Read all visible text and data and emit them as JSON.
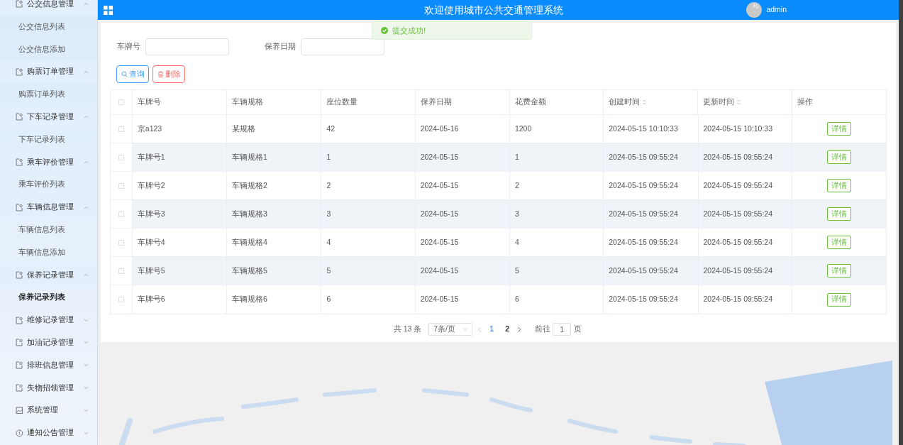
{
  "header": {
    "title": "欢迎使用城市公共交通管理系统",
    "user": "admin"
  },
  "toast": {
    "kind": "success",
    "text": "提交成功!"
  },
  "sidebar": {
    "groups": [
      {
        "label": "公交信息管理",
        "kind": "doc",
        "expanded": true,
        "children": [
          {
            "label": "公交信息列表",
            "selected": false
          },
          {
            "label": "公交信息添加",
            "selected": false
          }
        ]
      },
      {
        "label": "购票订单管理",
        "kind": "doc",
        "expanded": true,
        "children": [
          {
            "label": "购票订单列表",
            "selected": false
          }
        ]
      },
      {
        "label": "下车记录管理",
        "kind": "doc",
        "expanded": true,
        "children": [
          {
            "label": "下车记录列表",
            "selected": false
          }
        ]
      },
      {
        "label": "乘车评价管理",
        "kind": "doc",
        "expanded": true,
        "children": [
          {
            "label": "乘车评价列表",
            "selected": false
          }
        ]
      },
      {
        "label": "车辆信息管理",
        "kind": "doc",
        "expanded": true,
        "children": [
          {
            "label": "车辆信息列表",
            "selected": false
          },
          {
            "label": "车辆信息添加",
            "selected": false
          }
        ]
      },
      {
        "label": "保养记录管理",
        "kind": "doc",
        "expanded": true,
        "children": [
          {
            "label": "保养记录列表",
            "selected": true
          }
        ]
      },
      {
        "label": "维修记录管理",
        "kind": "doc",
        "expanded": false
      },
      {
        "label": "加油记录管理",
        "kind": "doc",
        "expanded": false
      },
      {
        "label": "排班信息管理",
        "kind": "doc",
        "expanded": false
      },
      {
        "label": "失物招领管理",
        "kind": "doc",
        "expanded": false
      },
      {
        "label": "系统管理",
        "kind": "image",
        "expanded": false
      },
      {
        "label": "通知公告管理",
        "kind": "info",
        "expanded": false
      }
    ]
  },
  "search": {
    "fields": [
      {
        "label": "车牌号"
      },
      {
        "label": "保养日期"
      }
    ],
    "buttons": [
      {
        "kind": "search",
        "label": "查询"
      },
      {
        "kind": "delete",
        "label": "删除"
      }
    ]
  },
  "table": {
    "header_checked": false,
    "columns": [
      {
        "label": "车牌号",
        "sortable": false
      },
      {
        "label": "车辆规格",
        "sortable": false
      },
      {
        "label": "座位数量",
        "sortable": false
      },
      {
        "label": "保养日期",
        "sortable": false
      },
      {
        "label": "花费金额",
        "sortable": false
      },
      {
        "label": "创建时间",
        "sortable": true
      },
      {
        "label": "更新时间",
        "sortable": true
      },
      {
        "label": "操作",
        "sortable": false
      }
    ],
    "rows": [
      {
        "checked": false,
        "cells": [
          "京a123",
          "某规格",
          "42",
          "2024-05-16",
          "1200",
          "2024-05-15 10:10:33",
          "2024-05-15 10:10:33"
        ],
        "action": "详情"
      },
      {
        "checked": false,
        "cells": [
          "车牌号1",
          "车辆规格1",
          "1",
          "2024-05-15",
          "1",
          "2024-05-15 09:55:24",
          "2024-05-15 09:55:24"
        ],
        "action": "详情"
      },
      {
        "checked": false,
        "cells": [
          "车牌号2",
          "车辆规格2",
          "2",
          "2024-05-15",
          "2",
          "2024-05-15 09:55:24",
          "2024-05-15 09:55:24"
        ],
        "action": "详情"
      },
      {
        "checked": false,
        "cells": [
          "车牌号3",
          "车辆规格3",
          "3",
          "2024-05-15",
          "3",
          "2024-05-15 09:55:24",
          "2024-05-15 09:55:24"
        ],
        "action": "详情"
      },
      {
        "checked": false,
        "cells": [
          "车牌号4",
          "车辆规格4",
          "4",
          "2024-05-15",
          "4",
          "2024-05-15 09:55:24",
          "2024-05-15 09:55:24"
        ],
        "action": "详情"
      },
      {
        "checked": false,
        "cells": [
          "车牌号5",
          "车辆规格5",
          "5",
          "2024-05-15",
          "5",
          "2024-05-15 09:55:24",
          "2024-05-15 09:55:24"
        ],
        "action": "详情"
      },
      {
        "checked": false,
        "cells": [
          "车牌号6",
          "车辆规格6",
          "6",
          "2024-05-15",
          "6",
          "2024-05-15 09:55:24",
          "2024-05-15 09:55:24"
        ],
        "action": "详情"
      }
    ]
  },
  "pagination": {
    "total": "共 13 条",
    "page_size": "7条/页",
    "pages": [
      {
        "label": "1",
        "selected": true
      },
      {
        "label": "2",
        "selected": false
      }
    ],
    "goto_label": "前往",
    "goto_value": "1",
    "goto_suffix": "页"
  }
}
